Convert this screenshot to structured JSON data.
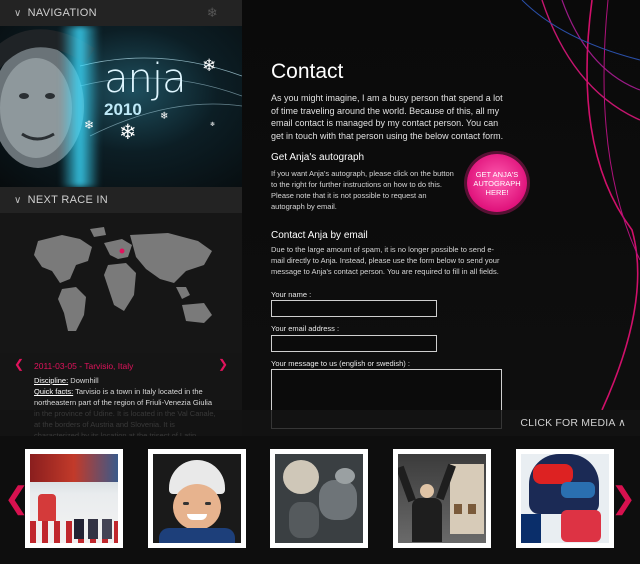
{
  "navigation": {
    "label": "NAVIGATION",
    "icon": "chevron-down-icon"
  },
  "banner": {
    "logo": "anja",
    "year": "2010"
  },
  "next_race": {
    "label": "NEXT RACE IN",
    "date_location": "2011-03-05 - Tarvisio, Italy",
    "discipline_label": "Discipline:",
    "discipline": "Downhill",
    "facts_label": "Quick facts:",
    "facts": "Tarvisio is a town in Italy located in the northeastern part of the region of Friuli-Venezia Giulia in the province of Udine. It is located in the Val Canale, at the borders of Austria and Slovenia. It is characterized by its location at the trisect of Latin, Germanic and Slavic Europe.",
    "map_marker_color": "#e0135c"
  },
  "contact": {
    "title": "Contact",
    "intro": "As you might imagine, I am a busy person that spend a lot of time traveling around the world. Because of this, all my email contact is managed by my contact person. You can get in touch with that person using the below contact form.",
    "autograph_heading": "Get Anja's autograph",
    "autograph_text": "If you want Anja's autograph, please click on the button to the right for further instructions on how to do this. Please note that it is not possible to request an autograph by email.",
    "autograph_button": "GET ANJA'S AUTOGRAPH HERE!",
    "email_heading": "Contact Anja by email",
    "email_text": "Due to the large amount of spam, it is no longer possible to send e-mail directly to Anja. Instead, please use the form below to send your message to Anja's contact person. You are required to fill in all fields.",
    "name_label": "Your name :",
    "email_label": "Your email address :",
    "message_label": "Your message to us (english or swedish) :",
    "name_value": "",
    "email_value": "",
    "message_value": ""
  },
  "media": {
    "label": "CLICK FOR MEDIA",
    "thumbnails": [
      "ski-race-photo",
      "portrait-photo",
      "helicopter-ride-photo",
      "celebration-photo",
      "helmet-photo"
    ]
  },
  "colors": {
    "accent": "#e0135c",
    "badge": "#e8177f",
    "background": "#0b0b0b"
  }
}
